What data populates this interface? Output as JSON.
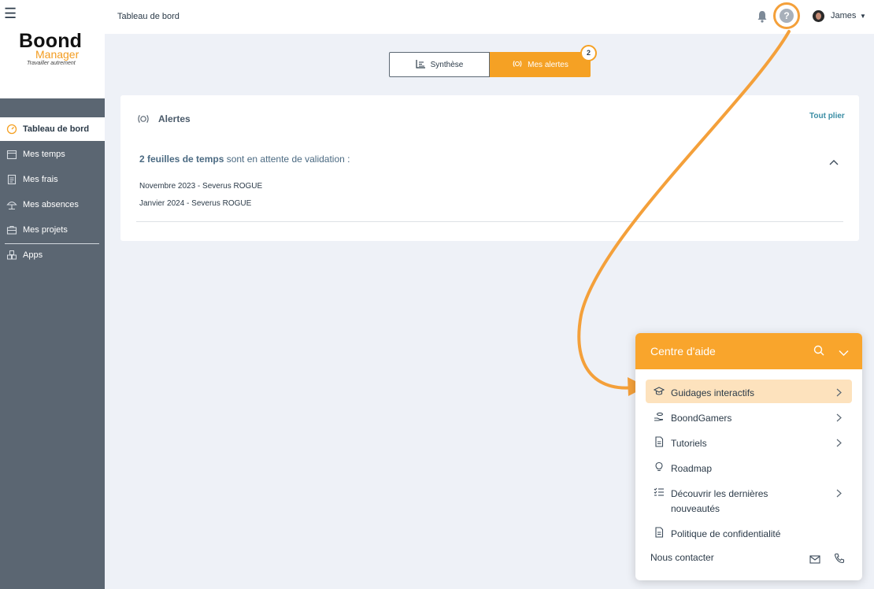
{
  "logo": {
    "title": "Boond",
    "subtitle": "Manager",
    "tagline": "Travailler autrement"
  },
  "sidebar": {
    "items": [
      {
        "label": "Tableau de bord",
        "icon": "dashboard-icon",
        "active": true
      },
      {
        "label": "Mes temps",
        "icon": "calendar-icon"
      },
      {
        "label": "Mes frais",
        "icon": "receipt-icon"
      },
      {
        "label": "Mes absences",
        "icon": "beach-umbrella-icon"
      },
      {
        "label": "Mes projets",
        "icon": "briefcase-icon"
      },
      {
        "label": "Apps",
        "icon": "apps-cubes-icon"
      }
    ]
  },
  "topbar": {
    "title": "Tableau de bord",
    "help_label": "?",
    "user": {
      "name": "James"
    }
  },
  "tabs": {
    "synthese": "Synthèse",
    "alertes": "Mes alertes",
    "badge": "2"
  },
  "alerts": {
    "title": "Alertes",
    "collapse_all": "Tout plier",
    "heading_bold": "2 feuilles de temps",
    "heading_rest": " sont en attente de validation :",
    "rows": [
      "Novembre 2023 - Severus ROGUE",
      "Janvier 2024 - Severus ROGUE"
    ]
  },
  "help_panel": {
    "title": "Centre d'aide",
    "items": [
      {
        "label": "Guidages interactifs",
        "icon": "graduation-cap-icon",
        "chevron": true,
        "highlighted": true
      },
      {
        "label": "BoondGamers",
        "icon": "hand-coins-icon",
        "chevron": true
      },
      {
        "label": "Tutoriels",
        "icon": "document-icon",
        "chevron": true
      },
      {
        "label": "Roadmap",
        "icon": "lightbulb-icon",
        "chevron": false
      },
      {
        "label_line1": "Découvrir les dernières",
        "label_line2": "nouveautés",
        "icon": "checklist-icon",
        "chevron": true
      },
      {
        "label": "Politique de confidentialité",
        "icon": "document-icon",
        "chevron": false
      }
    ],
    "contact": "Nous contacter"
  },
  "colors": {
    "accent": "#f5a124",
    "sidebar": "#5b6672",
    "background": "#eef1f7",
    "link": "#3b8ea5"
  }
}
